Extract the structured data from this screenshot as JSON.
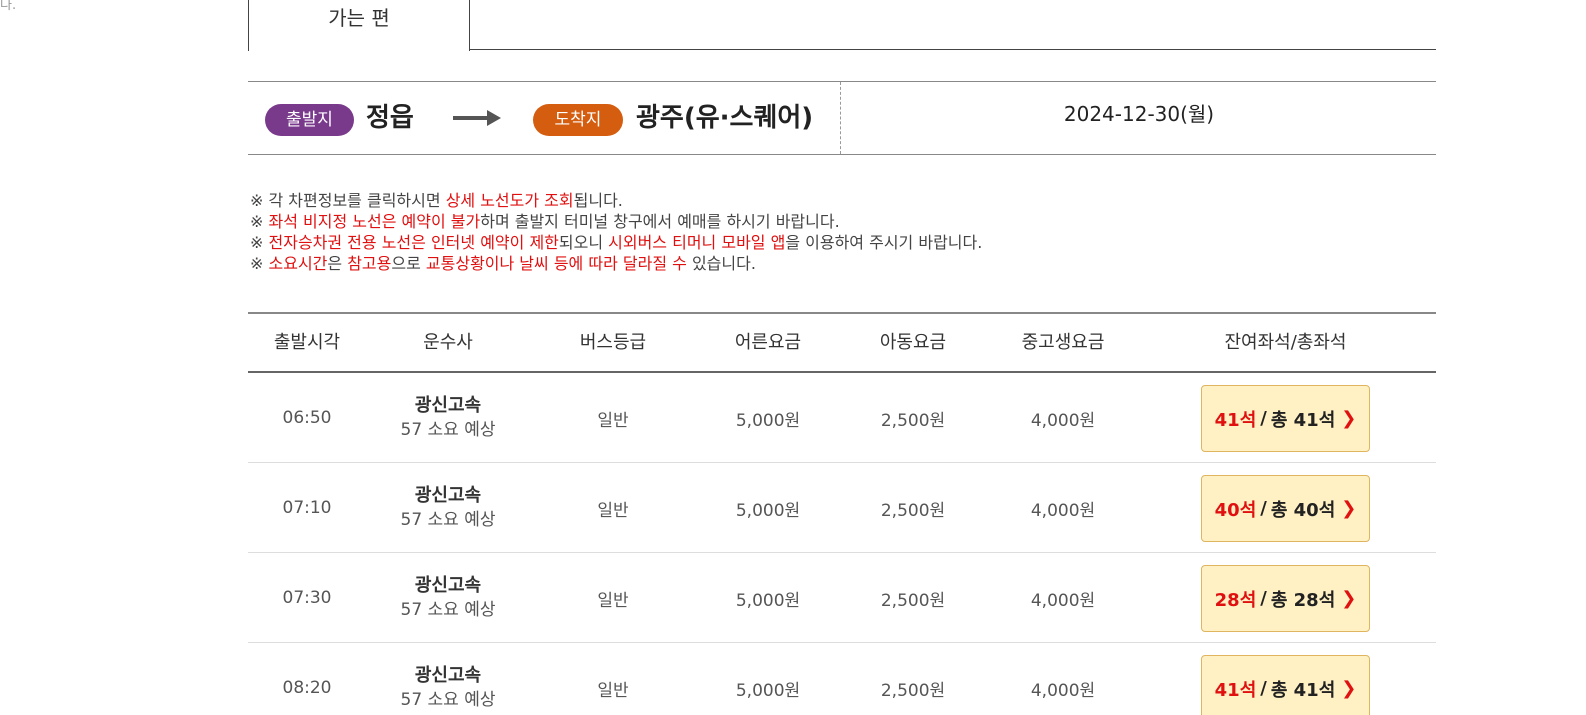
{
  "stray_text": "다.",
  "tabs": {
    "active_label": "가는 편"
  },
  "route": {
    "departure_badge": "출발지",
    "departure_place": "정읍",
    "arrival_badge": "도착지",
    "arrival_place": "광주(유·스퀘어)",
    "date": "2024-12-30(월)",
    "arrow_icon": "long-right-arrow",
    "colors": {
      "departure_badge": "#7a3a8c",
      "arrival_badge": "#d45d0f",
      "highlight": "#e01010"
    }
  },
  "notices": [
    {
      "segments": [
        {
          "t": "※ ",
          "h": false
        },
        {
          "t": "각 차편정보를 클릭하시면 ",
          "h": false
        },
        {
          "t": "상세 노선도가 조회",
          "h": true
        },
        {
          "t": "됩니다.",
          "h": false
        }
      ]
    },
    {
      "segments": [
        {
          "t": "※ ",
          "h": false
        },
        {
          "t": "좌석 비지정 노선은 예약이 불가",
          "h": true
        },
        {
          "t": "하며 출발지 터미널 창구에서 예매를 하시기 바랍니다.",
          "h": false
        }
      ]
    },
    {
      "segments": [
        {
          "t": "※ ",
          "h": false
        },
        {
          "t": "전자승차권 전용 노선은 인터넷 예약이 제한",
          "h": true
        },
        {
          "t": "되오니 ",
          "h": false
        },
        {
          "t": "시외버스 티머니 모바일 앱",
          "h": true
        },
        {
          "t": "을 이용하여 주시기 바랍니다.",
          "h": false
        }
      ]
    },
    {
      "segments": [
        {
          "t": "※ ",
          "h": false
        },
        {
          "t": "소요시간",
          "h": true
        },
        {
          "t": "은 ",
          "h": false
        },
        {
          "t": "참고용",
          "h": true
        },
        {
          "t": "으로 ",
          "h": false
        },
        {
          "t": "교통상황이나 날씨 등에 따라 달라질 수",
          "h": true
        },
        {
          "t": " 있습니다.",
          "h": false
        }
      ]
    }
  ],
  "table": {
    "headers": [
      "출발시각",
      "운수사",
      "버스등급",
      "어른요금",
      "아동요금",
      "중고생요금",
      "잔여좌석/총좌석"
    ],
    "rows": [
      {
        "time": "06:50",
        "company": "광신고속",
        "duration": "57 소요 예상",
        "grade": "일반",
        "adult": "5,000원",
        "child": "2,500원",
        "youth": "4,000원",
        "remain": "41석",
        "total": "총 41석"
      },
      {
        "time": "07:10",
        "company": "광신고속",
        "duration": "57 소요 예상",
        "grade": "일반",
        "adult": "5,000원",
        "child": "2,500원",
        "youth": "4,000원",
        "remain": "40석",
        "total": "총 40석"
      },
      {
        "time": "07:30",
        "company": "광신고속",
        "duration": "57 소요 예상",
        "grade": "일반",
        "adult": "5,000원",
        "child": "2,500원",
        "youth": "4,000원",
        "remain": "28석",
        "total": "총 28석"
      },
      {
        "time": "08:20",
        "company": "광신고속",
        "duration": "57 소요 예상",
        "grade": "일반",
        "adult": "5,000원",
        "child": "2,500원",
        "youth": "4,000원",
        "remain": "41석",
        "total": "총 41석"
      }
    ]
  }
}
